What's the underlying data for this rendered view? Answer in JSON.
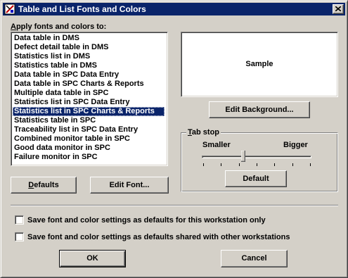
{
  "window": {
    "title": "Table and List Fonts and Colors"
  },
  "list": {
    "label_underlined": "A",
    "label_rest": "pply fonts and colors to:",
    "items": [
      "Data table in DMS",
      "Defect detail table in DMS",
      "Statistics list in DMS",
      "Statistics table in DMS",
      "Data table in SPC Data Entry",
      "Data table in SPC Charts & Reports",
      "Multiple data table in SPC",
      "Statistics list in SPC Data Entry",
      "Statistics list in SPC Charts & Reports",
      "Statistics table in SPC",
      "Traceability list in SPC Data Entry",
      "Combined monitor table in SPC",
      "Good data monitor in SPC",
      "Failure monitor in SPC"
    ],
    "selected_index": 8
  },
  "sample": {
    "text": "Sample"
  },
  "buttons": {
    "edit_background": "Edit Background...",
    "defaults_underlined": "D",
    "defaults_rest": "efaults",
    "edit_font": "Edit Font...",
    "tab_default": "Default",
    "ok": "OK",
    "cancel": "Cancel"
  },
  "tabstop": {
    "legend_underlined": "T",
    "legend_rest": "ab stop",
    "smaller": "Smaller",
    "bigger": "Bigger",
    "value_fraction": 0.375,
    "tick_count": 7
  },
  "checkboxes": {
    "workstation_only": {
      "label": "Save font and color settings as defaults for this workstation only",
      "checked": false
    },
    "shared": {
      "label": "Save font and color settings as defaults shared with other workstations",
      "checked": false
    }
  },
  "colors": {
    "titlebar": "#0a246a",
    "face": "#d4d0c8",
    "selection": "#0a246a"
  },
  "icons": {
    "title": "fonts-colors-app-icon",
    "close": "close-icon"
  }
}
